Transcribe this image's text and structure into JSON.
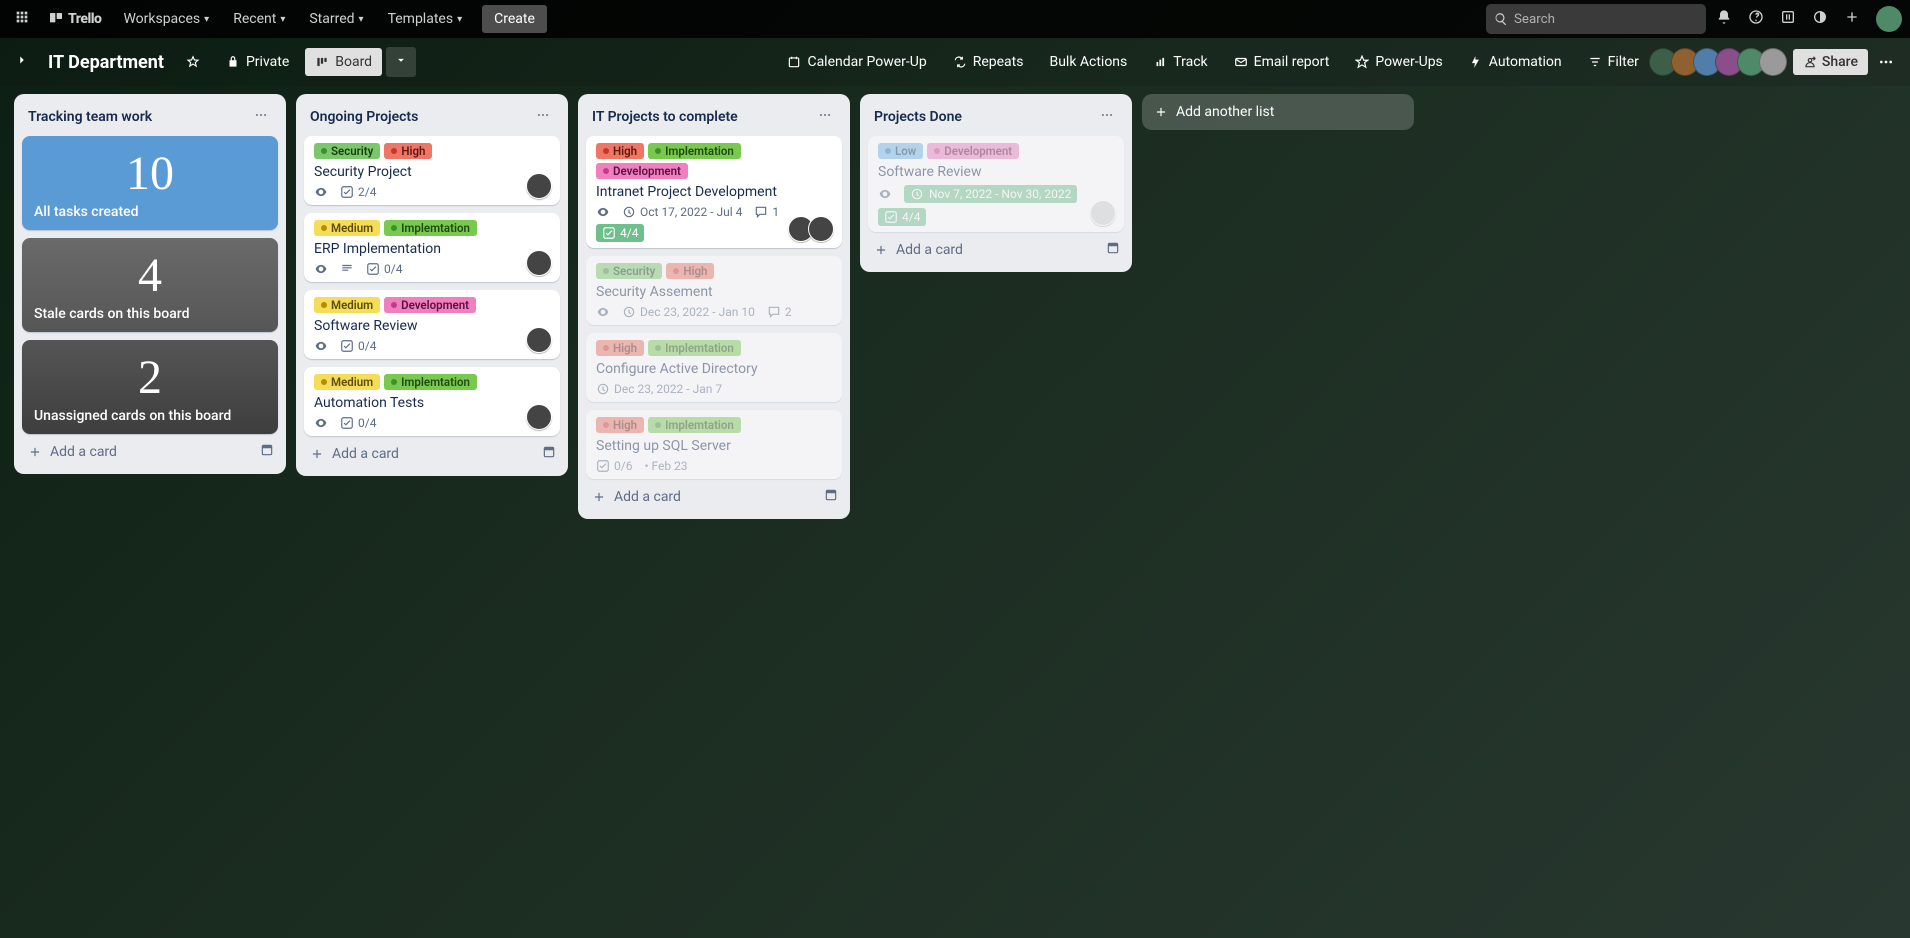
{
  "topbar": {
    "logo": "Trello",
    "workspaces": "Workspaces",
    "recent": "Recent",
    "starred": "Starred",
    "templates": "Templates",
    "create": "Create",
    "search_placeholder": "Search"
  },
  "boardbar": {
    "title": "IT Department",
    "private": "Private",
    "board": "Board",
    "calendar_pu": "Calendar Power-Up",
    "repeats": "Repeats",
    "bulk": "Bulk Actions",
    "track": "Track",
    "email": "Email report",
    "powerups": "Power-Ups",
    "automation": "Automation",
    "filter": "Filter",
    "share": "Share"
  },
  "add_list": "Add another list",
  "add_card": "Add a card",
  "lists": [
    {
      "name": "Tracking team work",
      "stats": [
        {
          "num": "10",
          "label": "All tasks created",
          "variant": "blue"
        },
        {
          "num": "4",
          "label": "Stale cards on this board",
          "variant": "gray1"
        },
        {
          "num": "2",
          "label": "Unassigned cards on this board",
          "variant": "gray2"
        }
      ]
    },
    {
      "name": "Ongoing Projects",
      "cards": [
        {
          "labels": [
            {
              "txt": "Security",
              "cls": "lbl-green"
            },
            {
              "txt": "High",
              "cls": "lbl-red"
            }
          ],
          "title": "Security Project",
          "badges": {
            "watch": true,
            "check": "2/4"
          },
          "members": 1
        },
        {
          "labels": [
            {
              "txt": "Medium",
              "cls": "lbl-yellow"
            },
            {
              "txt": "Implemtation",
              "cls": "lbl-lime"
            }
          ],
          "title": "ERP Implementation",
          "badges": {
            "watch": true,
            "desc": true,
            "check": "0/4"
          },
          "members": 1
        },
        {
          "labels": [
            {
              "txt": "Medium",
              "cls": "lbl-yellow"
            },
            {
              "txt": "Development",
              "cls": "lbl-pink"
            }
          ],
          "title": "Software Review",
          "badges": {
            "watch": true,
            "check": "0/4"
          },
          "members": 1
        },
        {
          "labels": [
            {
              "txt": "Medium",
              "cls": "lbl-yellow"
            },
            {
              "txt": "Implemtation",
              "cls": "lbl-lime"
            }
          ],
          "title": "Automation Tests",
          "badges": {
            "watch": true,
            "check": "0/4"
          },
          "members": 1
        }
      ]
    },
    {
      "name": "IT Projects to complete",
      "cards": [
        {
          "labels": [
            {
              "txt": "High",
              "cls": "lbl-red"
            },
            {
              "txt": "Implemtation",
              "cls": "lbl-lime"
            },
            {
              "txt": "Development",
              "cls": "lbl-pink"
            }
          ],
          "title": "Intranet Project Development",
          "badges": {
            "watch": true,
            "date": "Oct 17, 2022 - Jul 4",
            "comments": "1",
            "check_g": "4/4"
          },
          "members": 2
        },
        {
          "faded": true,
          "labels": [
            {
              "txt": "Security",
              "cls": "lbl-green"
            },
            {
              "txt": "High",
              "cls": "lbl-red"
            }
          ],
          "title": "Security Assement",
          "badges": {
            "watch": true,
            "date": "Dec 23, 2022 - Jan 10",
            "comments": "2"
          }
        },
        {
          "faded": true,
          "labels": [
            {
              "txt": "High",
              "cls": "lbl-red"
            },
            {
              "txt": "Implemtation",
              "cls": "lbl-lime"
            }
          ],
          "title": "Configure Active Directory",
          "badges": {
            "date": "Dec 23, 2022 - Jan 7"
          }
        },
        {
          "faded": true,
          "labels": [
            {
              "txt": "High",
              "cls": "lbl-red"
            },
            {
              "txt": "Implemtation",
              "cls": "lbl-lime"
            }
          ],
          "title": "Setting up SQL Server",
          "badges": {
            "check": "0/6",
            "date_plain": "Feb 23"
          }
        }
      ]
    },
    {
      "name": "Projects Done",
      "cards": [
        {
          "faded": true,
          "labels": [
            {
              "txt": "Low",
              "cls": "lbl-blue"
            },
            {
              "txt": "Development",
              "cls": "lbl-pink"
            }
          ],
          "title": "Software Review",
          "badges": {
            "watch": true,
            "date_g": "Nov 7, 2022 - Nov 30, 2022",
            "check_g": "4/4"
          },
          "members": 1,
          "member_gray": true
        }
      ]
    }
  ]
}
